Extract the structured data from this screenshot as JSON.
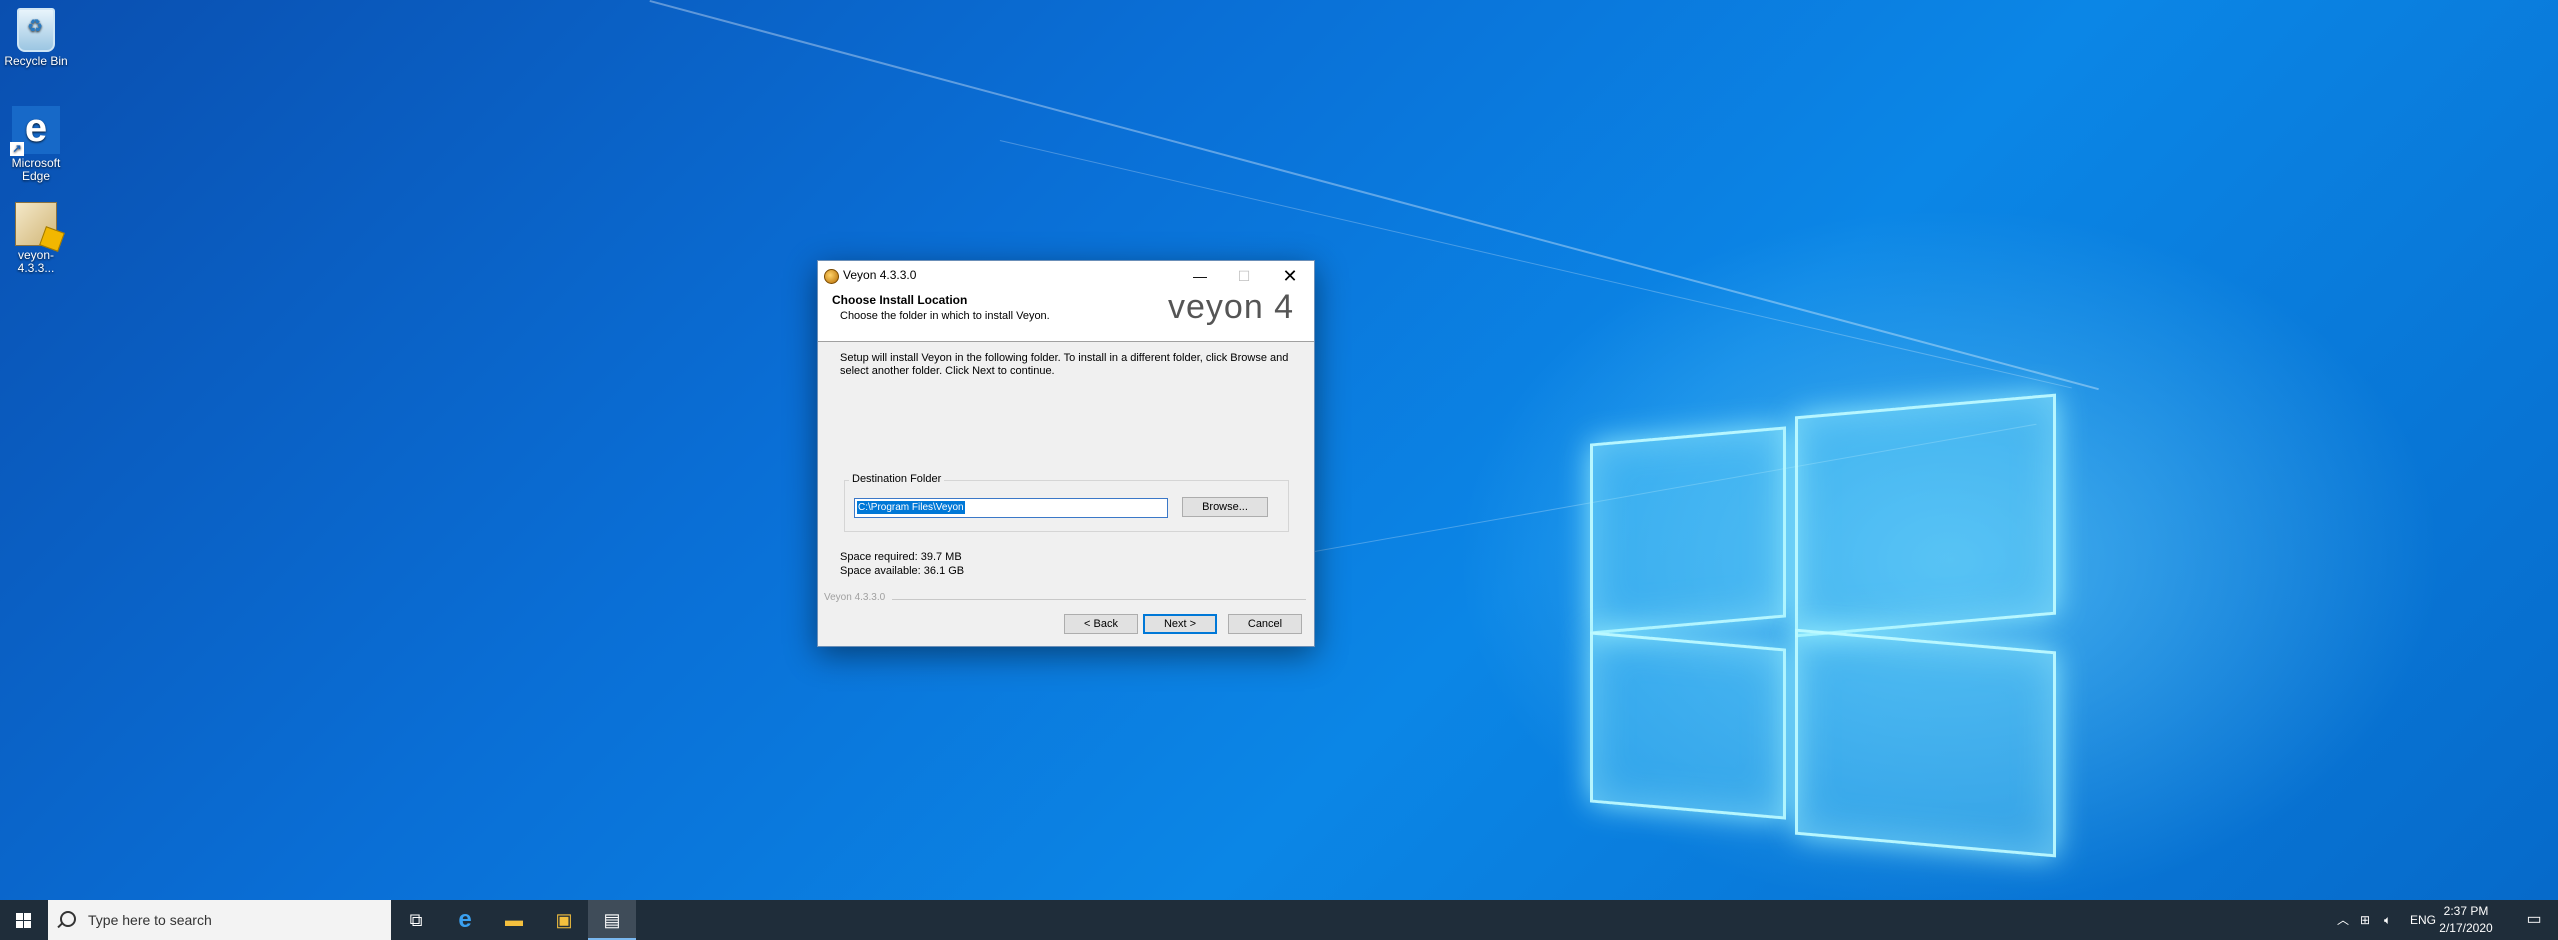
{
  "desktop": {
    "icons": [
      {
        "label": "Recycle Bin"
      },
      {
        "label": "Microsoft Edge"
      },
      {
        "label": "veyon-4.3.3..."
      }
    ]
  },
  "installer": {
    "window_title": "Veyon 4.3.3.0",
    "minimize_glyph": "—",
    "maximize_glyph": "☐",
    "close_glyph": "✕",
    "heading": "Choose Install Location",
    "subheading": "Choose the folder in which to install Veyon.",
    "brand": "veyon 4",
    "intro_text": "Setup will install Veyon in the following folder. To install in a different folder, click Browse and select another folder. Click Next to continue.",
    "destination_legend": "Destination Folder",
    "destination_path": "C:\\Program Files\\Veyon",
    "browse_label": "Browse...",
    "space_required": "Space required: 39.7 MB",
    "space_available": "Space available: 36.1 GB",
    "footer_label": "Veyon 4.3.3.0",
    "back_label": "< Back",
    "next_label": "Next >",
    "cancel_label": "Cancel"
  },
  "taskbar": {
    "search_placeholder": "Type here to search",
    "tray_language": "ENG",
    "time": "2:37 PM",
    "date": "2/17/2020"
  }
}
